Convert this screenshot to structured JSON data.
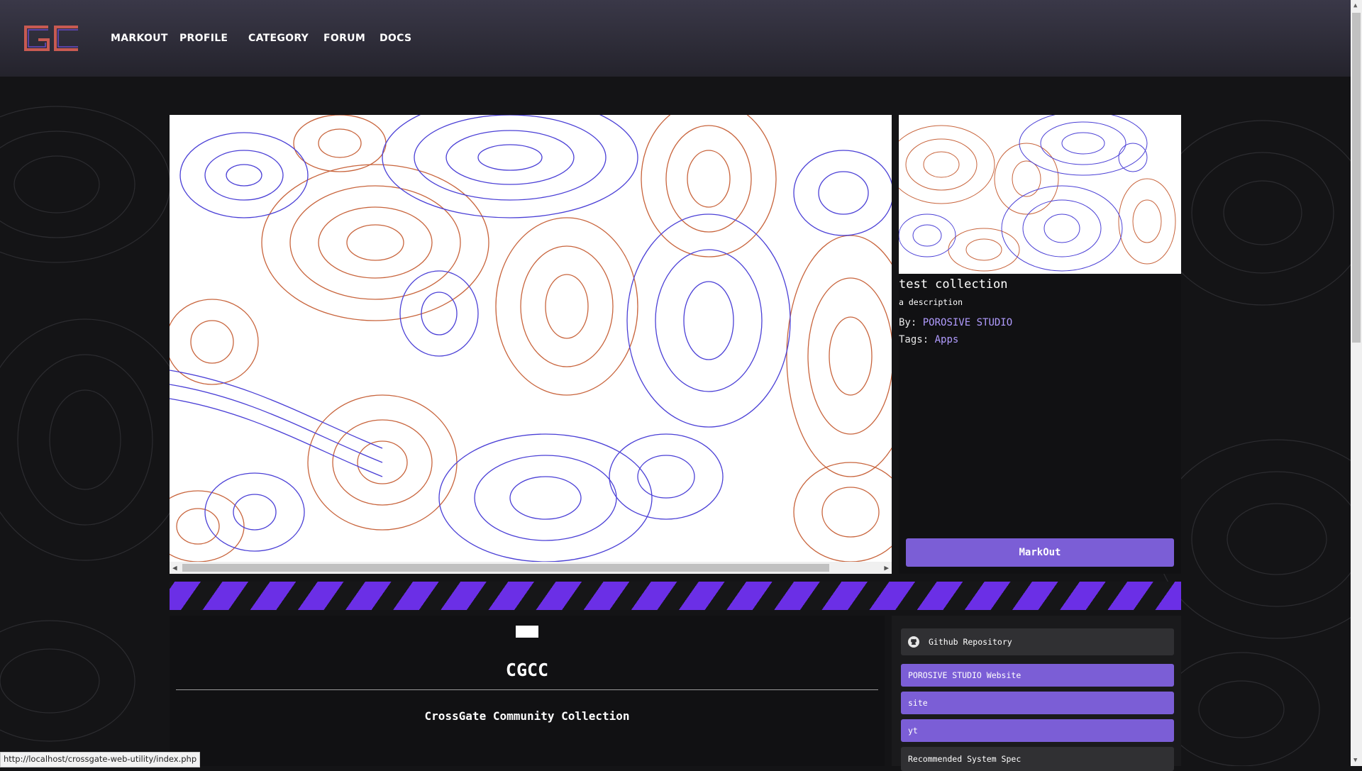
{
  "nav": {
    "logo_text": "GC",
    "links": [
      "MARKOUT",
      "PROFILE",
      "CATEGORY",
      "FORUM",
      "DOCS"
    ]
  },
  "collection": {
    "title": "test collection",
    "description": "a description",
    "by_label": "By:",
    "author": "POROSIVE STUDIO",
    "tags_label": "Tags:",
    "tag": "Apps",
    "action_button": "MarkOut"
  },
  "readme": {
    "heading": "CGCC",
    "subtitle": "CrossGate Community Collection"
  },
  "side_links": [
    {
      "label": "Github Repository",
      "icon": "github-icon",
      "style": "dark"
    },
    {
      "label": "POROSIVE STUDIO Website",
      "style": "accent"
    },
    {
      "label": "site",
      "style": "accent"
    },
    {
      "label": "yt",
      "style": "accent"
    },
    {
      "label": "Recommended System Spec",
      "style": "dark"
    }
  ],
  "status_bar": {
    "url": "http://localhost/crossgate-web-utility/index.php"
  },
  "colors": {
    "accent": "#7b5ed6",
    "stripe": "#6b2fe6",
    "link": "#b19cff",
    "contour_blue": "#4a3fd6",
    "contour_orange": "#c8643c"
  }
}
